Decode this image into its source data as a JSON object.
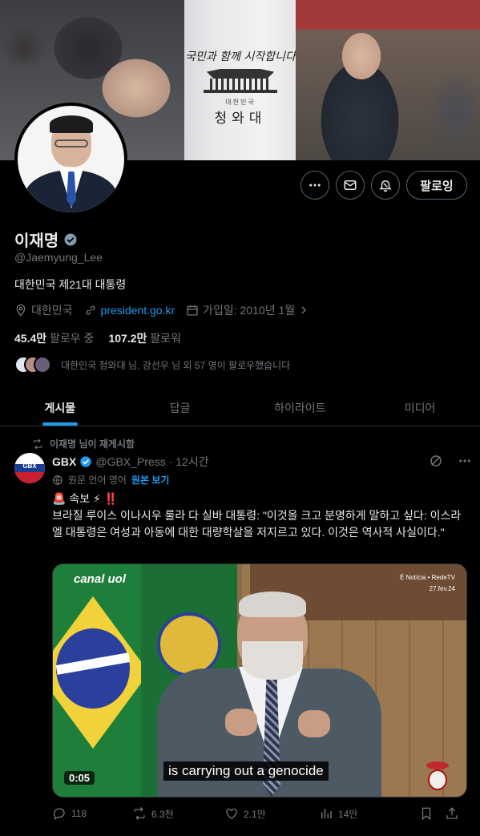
{
  "banner": {
    "slogan": "국민과 함께 시작합니다",
    "org_small": "대한민국",
    "org_big": "청와대"
  },
  "profile": {
    "name": "이재명",
    "handle": "@Jaemyung_Lee",
    "bio": "대한민국 제21대 대통령",
    "location": "대한민국",
    "website": "president.go.kr",
    "joined": "가입일: 2010년 1월",
    "following_count": "45.4만",
    "following_label": "팔로우 중",
    "followers_count": "107.2만",
    "followers_label": "팔로워",
    "followed_by": "대한민국 청와대 님, 강선우 님 외 57 명이 팔로우했습니다",
    "follow_button": "팔로잉"
  },
  "tabs": [
    {
      "label": "게시물",
      "active": true
    },
    {
      "label": "답글",
      "active": false
    },
    {
      "label": "하이라이트",
      "active": false
    },
    {
      "label": "미디어",
      "active": false
    }
  ],
  "post": {
    "repost_text": "이재명 님이 재게시함",
    "author_name": "GBX",
    "author_handle": "@GBX_Press",
    "time": "· 12시간",
    "avatar_text": "GBX",
    "translate_label": "원문 언어 영어",
    "translate_show": "원본 보기",
    "breaking": "🚨 속보 ⚡ ‼️",
    "text": "브라질 루이스 이나시우 룰라 다 실바 대통령: \"이것을 크고 분명하게 말하고 싶다: 이스라엘 대통령은 여성과 아동에 대한 대량학살을 저지르고 있다. 이것은 역사적 사실이다.\"",
    "video": {
      "logo_left": "canal uol",
      "logo_right_1": "É Notícia • RedeTV",
      "logo_right_2": "27.fev.24",
      "caption": "is carrying out a genocide",
      "duration": "0:05"
    },
    "stats": {
      "replies": "118",
      "reposts": "6.3천",
      "likes": "2.1만",
      "views": "14만"
    }
  },
  "colors": {
    "accent": "#1d9bf0",
    "background": "#000000",
    "muted": "#71767b",
    "text": "#e7e9ea"
  }
}
